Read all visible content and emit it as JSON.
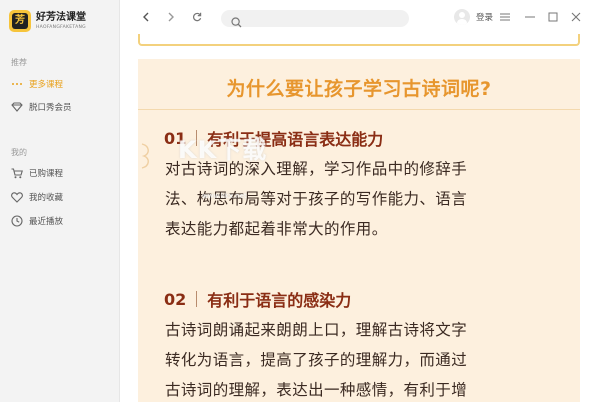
{
  "app": {
    "name": "好芳法课堂",
    "subtitle": "HAOFANGFAKETANG",
    "logo_char": "芳"
  },
  "sidebar": {
    "section_recommend": "推荐",
    "items_recommend": [
      {
        "label": "更多课程",
        "icon": "dots-icon",
        "active": true
      },
      {
        "label": "脱口秀会员",
        "icon": "diamond-icon",
        "active": false
      }
    ],
    "section_mine": "我的",
    "items_mine": [
      {
        "label": "已购课程",
        "icon": "cart-icon"
      },
      {
        "label": "我的收藏",
        "icon": "heart-icon"
      },
      {
        "label": "最近播放",
        "icon": "clock-icon"
      }
    ]
  },
  "topbar": {
    "search_placeholder": "",
    "login_label": "登录"
  },
  "article": {
    "title": "为什么要让孩子学习古诗词呢?",
    "sections": [
      {
        "number": "01",
        "heading": "有利于提高语言表达能力",
        "lines": [
          "对古诗词的深入理解，学习作品中的修辞手",
          "法、构思布局等对于孩子的写作能力、语言",
          "表达能力都起着非常大的作用。"
        ]
      },
      {
        "number": "02",
        "heading": "有利于语言的感染力",
        "lines": [
          "古诗词朗诵起来朗朗上口，理解古诗将文字",
          "转化为语言，提高了孩子的理解力，而通过",
          "古诗词的理解，表达出一种感情，有利于增"
        ]
      }
    ]
  },
  "watermark": {
    "text": "KK下载",
    "sub": "www.kkx.net"
  },
  "colors": {
    "accent": "#e9a21d",
    "title": "#e7962e",
    "heading": "#8a2d14",
    "article_bg": "#fdf0de",
    "sidebar_bg": "#f3f3f3"
  }
}
